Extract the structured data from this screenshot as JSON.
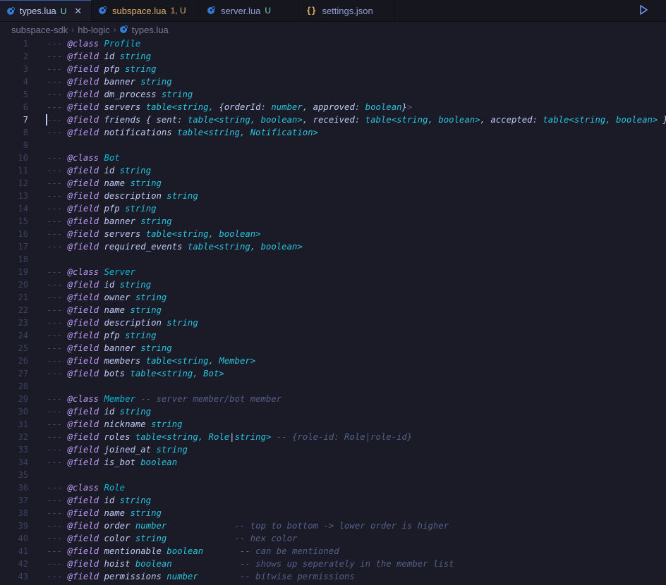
{
  "tabs": [
    {
      "name": "types.lua",
      "status": "U",
      "icon": "lua-icon",
      "active": true,
      "modified": false
    },
    {
      "name": "subspace.lua",
      "status": "1, U",
      "icon": "lua-icon",
      "active": false,
      "modified": true
    },
    {
      "name": "server.lua",
      "status": "U",
      "icon": "lua-icon",
      "active": false,
      "modified": false
    },
    {
      "name": "settings.json",
      "status": "",
      "icon": "json-icon",
      "active": false,
      "modified": false
    }
  ],
  "toolbar": {
    "run_icon": "play-icon",
    "more_icon": "more-icon"
  },
  "breadcrumb": [
    "subspace-sdk",
    "hb-logic",
    "types.lua"
  ],
  "editor": {
    "current_line": 7,
    "lines": [
      [
        [
          "d",
          "---"
        ],
        [
          "s",
          " "
        ],
        [
          "a",
          "@class"
        ],
        [
          "s",
          " "
        ],
        [
          "c",
          "Profile"
        ]
      ],
      [
        [
          "d",
          "---"
        ],
        [
          "s",
          " "
        ],
        [
          "a",
          "@field"
        ],
        [
          "s",
          " "
        ],
        [
          "n",
          "id"
        ],
        [
          "s",
          " "
        ],
        [
          "t",
          "string"
        ]
      ],
      [
        [
          "d",
          "---"
        ],
        [
          "s",
          " "
        ],
        [
          "a",
          "@field"
        ],
        [
          "s",
          " "
        ],
        [
          "n",
          "pfp"
        ],
        [
          "s",
          " "
        ],
        [
          "t",
          "string"
        ]
      ],
      [
        [
          "d",
          "---"
        ],
        [
          "s",
          " "
        ],
        [
          "a",
          "@field"
        ],
        [
          "s",
          " "
        ],
        [
          "n",
          "banner"
        ],
        [
          "s",
          " "
        ],
        [
          "t",
          "string"
        ]
      ],
      [
        [
          "d",
          "---"
        ],
        [
          "s",
          " "
        ],
        [
          "a",
          "@field"
        ],
        [
          "s",
          " "
        ],
        [
          "n",
          "dm_process"
        ],
        [
          "s",
          " "
        ],
        [
          "t",
          "string"
        ]
      ],
      [
        [
          "d",
          "---"
        ],
        [
          "s",
          " "
        ],
        [
          "a",
          "@field"
        ],
        [
          "s",
          " "
        ],
        [
          "n",
          "servers"
        ],
        [
          "s",
          " "
        ],
        [
          "t",
          "table<string, "
        ],
        [
          "b",
          "{"
        ],
        [
          "n",
          "orderId"
        ],
        [
          "p",
          ": "
        ],
        [
          "t",
          "number"
        ],
        [
          "p",
          ", "
        ],
        [
          "n",
          "approved"
        ],
        [
          "p",
          ": "
        ],
        [
          "t",
          "boolean"
        ],
        [
          "b",
          "}"
        ],
        [
          "m",
          ">"
        ]
      ],
      [
        [
          "d",
          "---"
        ],
        [
          "s",
          " "
        ],
        [
          "a",
          "@field"
        ],
        [
          "s",
          " "
        ],
        [
          "n",
          "friends"
        ],
        [
          "s",
          " "
        ],
        [
          "b",
          "{ "
        ],
        [
          "n",
          "sent"
        ],
        [
          "p",
          ": "
        ],
        [
          "t",
          "table<string, boolean>"
        ],
        [
          "p",
          ", "
        ],
        [
          "n",
          "received"
        ],
        [
          "p",
          ": "
        ],
        [
          "t",
          "table<string, boolean>"
        ],
        [
          "p",
          ", "
        ],
        [
          "n",
          "accepted"
        ],
        [
          "p",
          ": "
        ],
        [
          "t",
          "table<string, boolean>"
        ],
        [
          "b",
          " }"
        ]
      ],
      [
        [
          "d",
          "---"
        ],
        [
          "s",
          " "
        ],
        [
          "a",
          "@field"
        ],
        [
          "s",
          " "
        ],
        [
          "n",
          "notifications"
        ],
        [
          "s",
          " "
        ],
        [
          "t",
          "table<string, Notification>"
        ]
      ],
      [],
      [
        [
          "d",
          "---"
        ],
        [
          "s",
          " "
        ],
        [
          "a",
          "@class"
        ],
        [
          "s",
          " "
        ],
        [
          "c",
          "Bot"
        ]
      ],
      [
        [
          "d",
          "---"
        ],
        [
          "s",
          " "
        ],
        [
          "a",
          "@field"
        ],
        [
          "s",
          " "
        ],
        [
          "n",
          "id"
        ],
        [
          "s",
          " "
        ],
        [
          "t",
          "string"
        ]
      ],
      [
        [
          "d",
          "---"
        ],
        [
          "s",
          " "
        ],
        [
          "a",
          "@field"
        ],
        [
          "s",
          " "
        ],
        [
          "n",
          "name"
        ],
        [
          "s",
          " "
        ],
        [
          "t",
          "string"
        ]
      ],
      [
        [
          "d",
          "---"
        ],
        [
          "s",
          " "
        ],
        [
          "a",
          "@field"
        ],
        [
          "s",
          " "
        ],
        [
          "n",
          "description"
        ],
        [
          "s",
          " "
        ],
        [
          "t",
          "string"
        ]
      ],
      [
        [
          "d",
          "---"
        ],
        [
          "s",
          " "
        ],
        [
          "a",
          "@field"
        ],
        [
          "s",
          " "
        ],
        [
          "n",
          "pfp"
        ],
        [
          "s",
          " "
        ],
        [
          "t",
          "string"
        ]
      ],
      [
        [
          "d",
          "---"
        ],
        [
          "s",
          " "
        ],
        [
          "a",
          "@field"
        ],
        [
          "s",
          " "
        ],
        [
          "n",
          "banner"
        ],
        [
          "s",
          " "
        ],
        [
          "t",
          "string"
        ]
      ],
      [
        [
          "d",
          "---"
        ],
        [
          "s",
          " "
        ],
        [
          "a",
          "@field"
        ],
        [
          "s",
          " "
        ],
        [
          "n",
          "servers"
        ],
        [
          "s",
          " "
        ],
        [
          "t",
          "table<string, boolean>"
        ]
      ],
      [
        [
          "d",
          "---"
        ],
        [
          "s",
          " "
        ],
        [
          "a",
          "@field"
        ],
        [
          "s",
          " "
        ],
        [
          "n",
          "required_events"
        ],
        [
          "s",
          " "
        ],
        [
          "t",
          "table<string, boolean>"
        ]
      ],
      [],
      [
        [
          "d",
          "---"
        ],
        [
          "s",
          " "
        ],
        [
          "a",
          "@class"
        ],
        [
          "s",
          " "
        ],
        [
          "c",
          "Server"
        ]
      ],
      [
        [
          "d",
          "---"
        ],
        [
          "s",
          " "
        ],
        [
          "a",
          "@field"
        ],
        [
          "s",
          " "
        ],
        [
          "n",
          "id"
        ],
        [
          "s",
          " "
        ],
        [
          "t",
          "string"
        ]
      ],
      [
        [
          "d",
          "---"
        ],
        [
          "s",
          " "
        ],
        [
          "a",
          "@field"
        ],
        [
          "s",
          " "
        ],
        [
          "n",
          "owner"
        ],
        [
          "s",
          " "
        ],
        [
          "t",
          "string"
        ]
      ],
      [
        [
          "d",
          "---"
        ],
        [
          "s",
          " "
        ],
        [
          "a",
          "@field"
        ],
        [
          "s",
          " "
        ],
        [
          "n",
          "name"
        ],
        [
          "s",
          " "
        ],
        [
          "t",
          "string"
        ]
      ],
      [
        [
          "d",
          "---"
        ],
        [
          "s",
          " "
        ],
        [
          "a",
          "@field"
        ],
        [
          "s",
          " "
        ],
        [
          "n",
          "description"
        ],
        [
          "s",
          " "
        ],
        [
          "t",
          "string"
        ]
      ],
      [
        [
          "d",
          "---"
        ],
        [
          "s",
          " "
        ],
        [
          "a",
          "@field"
        ],
        [
          "s",
          " "
        ],
        [
          "n",
          "pfp"
        ],
        [
          "s",
          " "
        ],
        [
          "t",
          "string"
        ]
      ],
      [
        [
          "d",
          "---"
        ],
        [
          "s",
          " "
        ],
        [
          "a",
          "@field"
        ],
        [
          "s",
          " "
        ],
        [
          "n",
          "banner"
        ],
        [
          "s",
          " "
        ],
        [
          "t",
          "string"
        ]
      ],
      [
        [
          "d",
          "---"
        ],
        [
          "s",
          " "
        ],
        [
          "a",
          "@field"
        ],
        [
          "s",
          " "
        ],
        [
          "n",
          "members"
        ],
        [
          "s",
          " "
        ],
        [
          "t",
          "table<string, Member>"
        ]
      ],
      [
        [
          "d",
          "---"
        ],
        [
          "s",
          " "
        ],
        [
          "a",
          "@field"
        ],
        [
          "s",
          " "
        ],
        [
          "n",
          "bots"
        ],
        [
          "s",
          " "
        ],
        [
          "t",
          "table<string, Bot>"
        ]
      ],
      [],
      [
        [
          "d",
          "---"
        ],
        [
          "s",
          " "
        ],
        [
          "a",
          "@class"
        ],
        [
          "s",
          " "
        ],
        [
          "c",
          "Member"
        ],
        [
          "s",
          " "
        ],
        [
          "m",
          "-- server member/bot member"
        ]
      ],
      [
        [
          "d",
          "---"
        ],
        [
          "s",
          " "
        ],
        [
          "a",
          "@field"
        ],
        [
          "s",
          " "
        ],
        [
          "n",
          "id"
        ],
        [
          "s",
          " "
        ],
        [
          "t",
          "string"
        ]
      ],
      [
        [
          "d",
          "---"
        ],
        [
          "s",
          " "
        ],
        [
          "a",
          "@field"
        ],
        [
          "s",
          " "
        ],
        [
          "n",
          "nickname"
        ],
        [
          "s",
          " "
        ],
        [
          "t",
          "string"
        ]
      ],
      [
        [
          "d",
          "---"
        ],
        [
          "s",
          " "
        ],
        [
          "a",
          "@field"
        ],
        [
          "s",
          " "
        ],
        [
          "n",
          "roles"
        ],
        [
          "s",
          " "
        ],
        [
          "t",
          "table<string, Role"
        ],
        [
          "b",
          "|"
        ],
        [
          "t",
          "string>"
        ],
        [
          "s",
          " "
        ],
        [
          "m",
          "-- {role-id: Role|role-id}"
        ]
      ],
      [
        [
          "d",
          "---"
        ],
        [
          "s",
          " "
        ],
        [
          "a",
          "@field"
        ],
        [
          "s",
          " "
        ],
        [
          "n",
          "joined_at"
        ],
        [
          "s",
          " "
        ],
        [
          "t",
          "string"
        ]
      ],
      [
        [
          "d",
          "---"
        ],
        [
          "s",
          " "
        ],
        [
          "a",
          "@field"
        ],
        [
          "s",
          " "
        ],
        [
          "n",
          "is_bot"
        ],
        [
          "s",
          " "
        ],
        [
          "t",
          "boolean"
        ]
      ],
      [],
      [
        [
          "d",
          "---"
        ],
        [
          "s",
          " "
        ],
        [
          "a",
          "@class"
        ],
        [
          "s",
          " "
        ],
        [
          "c",
          "Role"
        ]
      ],
      [
        [
          "d",
          "---"
        ],
        [
          "s",
          " "
        ],
        [
          "a",
          "@field"
        ],
        [
          "s",
          " "
        ],
        [
          "n",
          "id"
        ],
        [
          "s",
          " "
        ],
        [
          "t",
          "string"
        ]
      ],
      [
        [
          "d",
          "---"
        ],
        [
          "s",
          " "
        ],
        [
          "a",
          "@field"
        ],
        [
          "s",
          " "
        ],
        [
          "n",
          "name"
        ],
        [
          "s",
          " "
        ],
        [
          "t",
          "string"
        ]
      ],
      [
        [
          "d",
          "---"
        ],
        [
          "s",
          " "
        ],
        [
          "a",
          "@field"
        ],
        [
          "s",
          " "
        ],
        [
          "n",
          "order"
        ],
        [
          "s",
          " "
        ],
        [
          "t",
          "number"
        ],
        [
          "s",
          "             "
        ],
        [
          "m",
          "-- top to bottom -> lower order is higher"
        ]
      ],
      [
        [
          "d",
          "---"
        ],
        [
          "s",
          " "
        ],
        [
          "a",
          "@field"
        ],
        [
          "s",
          " "
        ],
        [
          "n",
          "color"
        ],
        [
          "s",
          " "
        ],
        [
          "t",
          "string"
        ],
        [
          "s",
          "             "
        ],
        [
          "m",
          "-- hex color"
        ]
      ],
      [
        [
          "d",
          "---"
        ],
        [
          "s",
          " "
        ],
        [
          "a",
          "@field"
        ],
        [
          "s",
          " "
        ],
        [
          "n",
          "mentionable"
        ],
        [
          "s",
          " "
        ],
        [
          "t",
          "boolean"
        ],
        [
          "s",
          "       "
        ],
        [
          "m",
          "-- can be mentioned"
        ]
      ],
      [
        [
          "d",
          "---"
        ],
        [
          "s",
          " "
        ],
        [
          "a",
          "@field"
        ],
        [
          "s",
          " "
        ],
        [
          "n",
          "hoist"
        ],
        [
          "s",
          " "
        ],
        [
          "t",
          "boolean"
        ],
        [
          "s",
          "             "
        ],
        [
          "m",
          "-- shows up seperately in the member list"
        ]
      ],
      [
        [
          "d",
          "---"
        ],
        [
          "s",
          " "
        ],
        [
          "a",
          "@field"
        ],
        [
          "s",
          " "
        ],
        [
          "n",
          "permissions"
        ],
        [
          "s",
          " "
        ],
        [
          "t",
          "number"
        ],
        [
          "s",
          "        "
        ],
        [
          "m",
          "-- bitwise permissions"
        ]
      ]
    ]
  }
}
